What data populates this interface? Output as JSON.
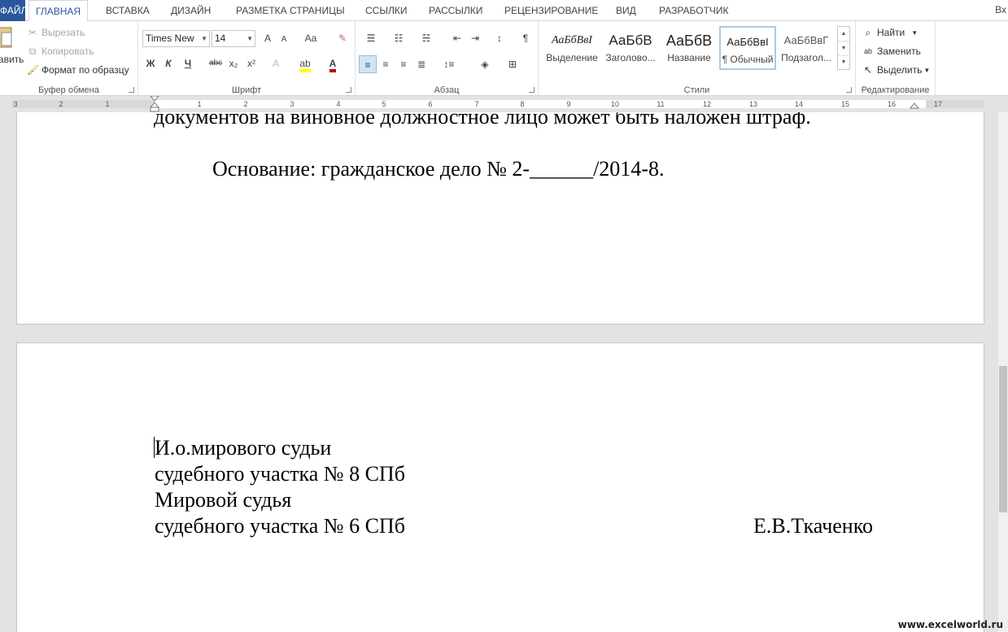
{
  "tabs": {
    "file": "ФАЙЛ",
    "home": "ГЛАВНАЯ",
    "insert": "ВСТАВКА",
    "design": "ДИЗАЙН",
    "layout": "РАЗМЕТКА СТРАНИЦЫ",
    "references": "ССЫЛКИ",
    "mailings": "РАССЫЛКИ",
    "review": "РЕЦЕНЗИРОВАНИЕ",
    "view": "ВИД",
    "developer": "РАЗРАБОТЧИК",
    "login": "Вх"
  },
  "clipboard": {
    "paste": "Вставить",
    "cut": "Вырезать",
    "copy": "Копировать",
    "format_painter": "Формат по образцу",
    "label": "Буфер обмена"
  },
  "font": {
    "name": "Times New Roman",
    "size": "14",
    "bold": "Ж",
    "italic": "К",
    "underline": "Ч",
    "strike": "abc",
    "subscript": "x₂",
    "superscript": "x²",
    "grow": "A",
    "shrink": "A",
    "case": "Aa",
    "label": "Шрифт"
  },
  "paragraph": {
    "label": "Абзац"
  },
  "styles": {
    "label": "Стили",
    "items": [
      {
        "sample": "АаБбВвІ",
        "name": "Выделение"
      },
      {
        "sample": "АаБбВ",
        "name": "Заголово..."
      },
      {
        "sample": "АаБбВ",
        "name": "Название"
      },
      {
        "sample": "АаБбВвІ",
        "name": "¶ Обычный"
      },
      {
        "sample": "АаБбВвГ",
        "name": "Подзагол..."
      }
    ]
  },
  "editing": {
    "find": "Найти",
    "replace": "Заменить",
    "select": "Выделить",
    "label": "Редактирование"
  },
  "ruler": {
    "left_numbers": [
      "3",
      "2",
      "1"
    ],
    "right_numbers": [
      "1",
      "2",
      "3",
      "4",
      "5",
      "6",
      "7",
      "8",
      "9",
      "10",
      "11",
      "12",
      "13",
      "14",
      "15",
      "16",
      "17"
    ]
  },
  "document": {
    "page1_line1": "документов на виновное должностное лицо может быть наложен штраф.",
    "page1_line2": "Основание: гражданское дело № 2-______/2014-8.",
    "page2_line1": "И.о.мирового судьи",
    "page2_line2": "судебного участка № 8 СПб",
    "page2_line3": "Мировой судья",
    "page2_line4": "судебного участка № 6 СПб",
    "page2_signature": "Е.В.Ткаченко"
  },
  "watermark": "www.excelworld.ru",
  "colors": {
    "accent": "#2b579a",
    "highlight": "#ffff00",
    "font_color": "#c00000"
  }
}
